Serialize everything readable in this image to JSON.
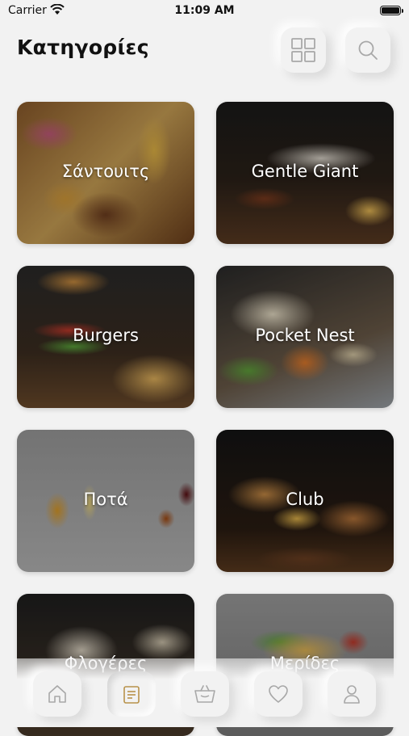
{
  "status_bar": {
    "carrier": "Carrier",
    "time": "11:09 AM"
  },
  "header": {
    "title": "Κατηγορίες",
    "grid_icon": "grid-icon",
    "search_icon": "search-icon"
  },
  "categories": [
    {
      "label": "Σάντουιτς"
    },
    {
      "label": "Gentle Giant"
    },
    {
      "label": "Burgers"
    },
    {
      "label": "Pocket Nest"
    },
    {
      "label": "Ποτά"
    },
    {
      "label": "Club"
    },
    {
      "label": "Φλογέρες"
    },
    {
      "label": "Μερίδες"
    }
  ],
  "tab_bar": {
    "items": [
      {
        "icon": "home-icon"
      },
      {
        "icon": "menu-icon",
        "active": true
      },
      {
        "icon": "basket-icon"
      },
      {
        "icon": "heart-icon"
      },
      {
        "icon": "user-icon"
      }
    ],
    "active_color": "#b8924a",
    "icon_color": "#9a9a9a"
  }
}
